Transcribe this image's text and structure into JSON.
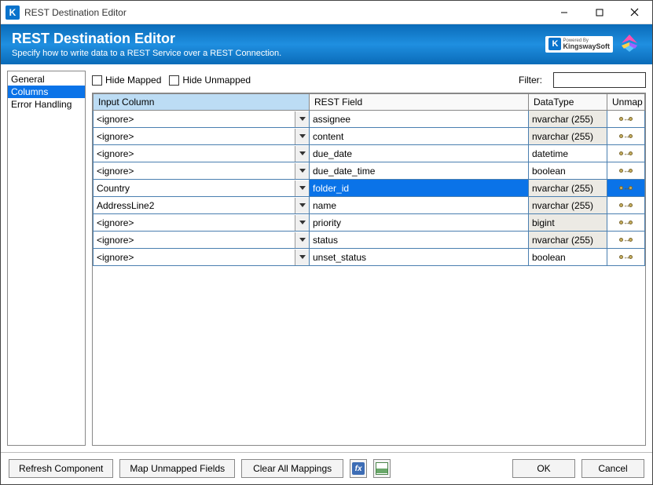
{
  "window": {
    "title": "REST Destination Editor"
  },
  "header": {
    "title": "REST Destination Editor",
    "subtitle": "Specify how to write data to a REST Service over a REST Connection.",
    "poweredByLabel": "Powered By",
    "kwsBrand": "KingswaySoft"
  },
  "sidebar": {
    "items": [
      {
        "label": "General",
        "selected": false
      },
      {
        "label": "Columns",
        "selected": true
      },
      {
        "label": "Error Handling",
        "selected": false
      }
    ]
  },
  "toolbar": {
    "hideMapped": "Hide Mapped",
    "hideUnmapped": "Hide Unmapped",
    "filterLabel": "Filter:",
    "filterValue": ""
  },
  "grid": {
    "headers": {
      "input": "Input Column",
      "restField": "REST Field",
      "dataType": "DataType",
      "unmap": "Unmap"
    },
    "rows": [
      {
        "input": "<ignore>",
        "rest": "assignee",
        "type": "nvarchar (255)",
        "typeShaded": true,
        "selected": false
      },
      {
        "input": "<ignore>",
        "rest": "content",
        "type": "nvarchar (255)",
        "typeShaded": true,
        "selected": false
      },
      {
        "input": "<ignore>",
        "rest": "due_date",
        "type": "datetime",
        "typeShaded": false,
        "selected": false
      },
      {
        "input": "<ignore>",
        "rest": "due_date_time",
        "type": "boolean",
        "typeShaded": false,
        "selected": false
      },
      {
        "input": "Country",
        "rest": "folder_id",
        "type": "nvarchar (255)",
        "typeShaded": true,
        "selected": true
      },
      {
        "input": "AddressLine2",
        "rest": "name",
        "type": "nvarchar (255)",
        "typeShaded": true,
        "selected": false
      },
      {
        "input": "<ignore>",
        "rest": "priority",
        "type": "bigint",
        "typeShaded": true,
        "selected": false
      },
      {
        "input": "<ignore>",
        "rest": "status",
        "type": "nvarchar (255)",
        "typeShaded": true,
        "selected": false
      },
      {
        "input": "<ignore>",
        "rest": "unset_status",
        "type": "boolean",
        "typeShaded": false,
        "selected": false
      }
    ]
  },
  "footer": {
    "refresh": "Refresh Component",
    "mapUnmapped": "Map Unmapped Fields",
    "clearAll": "Clear All Mappings",
    "ok": "OK",
    "cancel": "Cancel"
  }
}
